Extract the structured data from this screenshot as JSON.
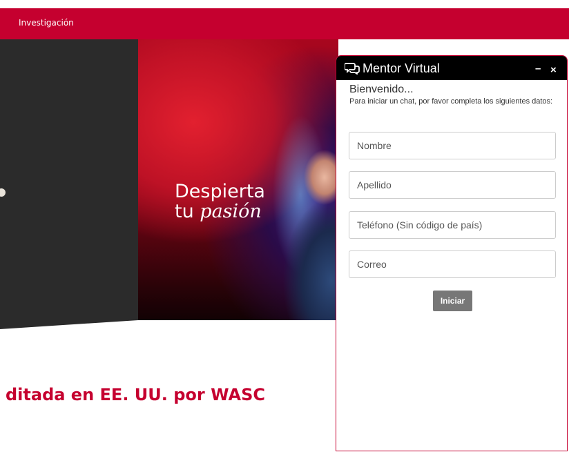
{
  "nav": {
    "link": "Investigación"
  },
  "hero": {
    "line1": "Despierta",
    "line2_prefix": "tu ",
    "line2_italic": "pasión"
  },
  "headline": "ditada en EE. UU. por WASC",
  "chat": {
    "title": "Mentor Virtual",
    "minimize": "–",
    "close": "×",
    "welcome": "Bienvenido...",
    "instructions": "Para iniciar un chat, por favor completa los siguientes datos:",
    "fields": {
      "name": "Nombre",
      "lastname": "Apellido",
      "phone": "Teléfono (Sin código de país)",
      "email": "Correo"
    },
    "start_button": "Iniciar"
  },
  "colors": {
    "brand": "#c5002f",
    "header": "#000000",
    "dark_panel": "#2b2b2b"
  },
  "icons": {
    "chat": "chat-bubbles-icon"
  }
}
